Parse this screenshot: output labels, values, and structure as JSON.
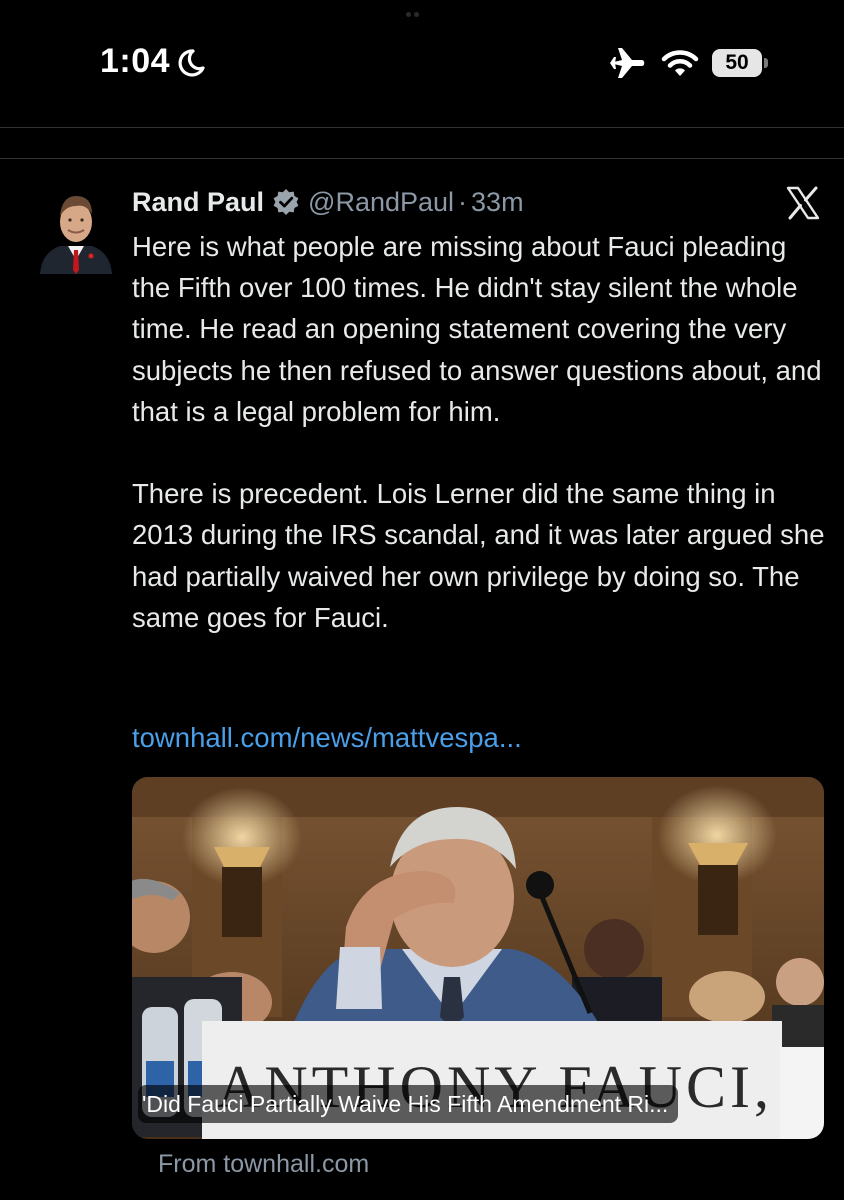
{
  "status_bar": {
    "time": "1:04",
    "battery_level": "50",
    "icons": [
      "moon-icon",
      "airplane-icon",
      "wifi-icon",
      "battery-icon"
    ]
  },
  "tweet": {
    "author_name": "Rand Paul",
    "handle": "@RandPaul",
    "separator": "·",
    "age": "33m",
    "paragraphs": [
      "Here is what people are missing about Fauci pleading the Fifth over 100 times. He didn't stay silent the whole time. He read an opening statement covering the very subjects he then refused to answer questions about, and that is a legal problem for him.",
      "There is precedent. Lois Lerner did the same thing in 2013 during the IRS scandal, and it was later argued she had partially waived her own privilege by doing so. The same goes for Fauci."
    ],
    "link_text": "townhall.com/news/mattvespa...",
    "card": {
      "title": "'Did Fauci Partially Waive His Fifth Amendment Ri...",
      "nameplate": "ANTHONY FAUCI, M.D.",
      "source": "From townhall.com"
    }
  },
  "colors": {
    "background": "#000000",
    "text": "#e7e9ea",
    "secondary_text": "#8b98a5",
    "link": "#4a9fe8",
    "verified_badge": "#9aa4ad"
  }
}
